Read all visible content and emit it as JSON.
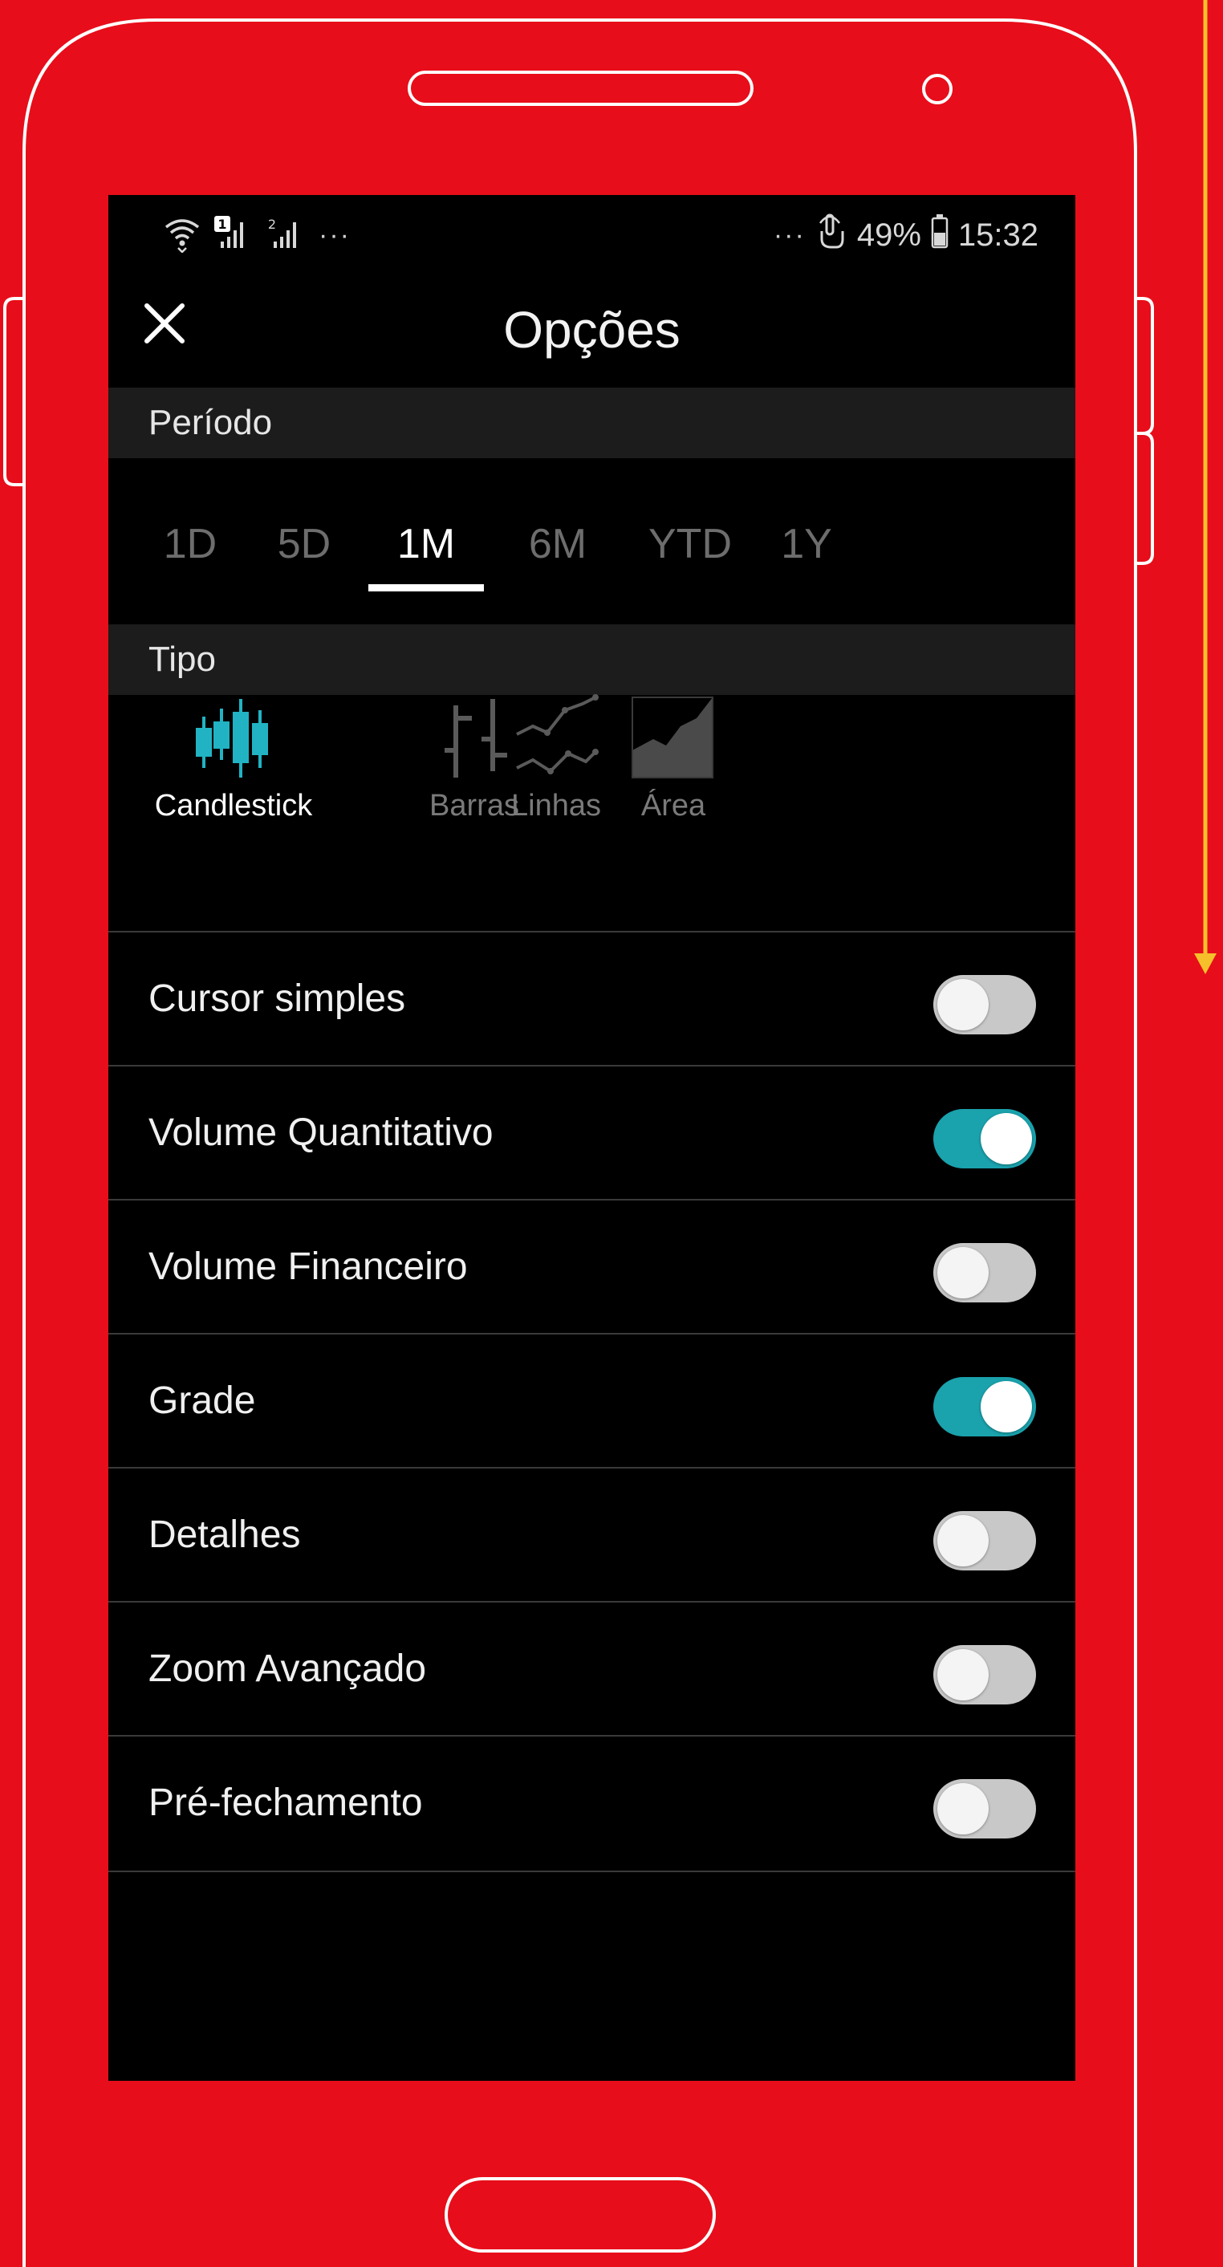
{
  "status_bar": {
    "left_dots": "···",
    "right_dots": "···",
    "battery": "49%",
    "time": "15:32",
    "sim1_badge": "1",
    "sim2_badge": "2"
  },
  "header": {
    "title": "Opções"
  },
  "sections": {
    "period": "Período",
    "type": "Tipo"
  },
  "period_tabs": [
    {
      "label": "1D",
      "active": false
    },
    {
      "label": "5D",
      "active": false
    },
    {
      "label": "1M",
      "active": true
    },
    {
      "label": "6M",
      "active": false
    },
    {
      "label": "YTD",
      "active": false
    },
    {
      "label": "1Y",
      "active": false
    }
  ],
  "chart_types": [
    {
      "label": "Candlestick",
      "icon": "candlestick-icon",
      "active": true
    },
    {
      "label": "Barras",
      "icon": "bars-icon",
      "active": false
    },
    {
      "label": "Linhas",
      "icon": "lines-icon",
      "active": false
    },
    {
      "label": "Área",
      "icon": "area-icon",
      "active": false
    }
  ],
  "options": [
    {
      "label": "Cursor simples",
      "on": false
    },
    {
      "label": "Volume Quantitativo",
      "on": true
    },
    {
      "label": "Volume Financeiro",
      "on": false
    },
    {
      "label": "Grade",
      "on": true
    },
    {
      "label": "Detalhes",
      "on": false
    },
    {
      "label": "Zoom Avançado",
      "on": false
    },
    {
      "label": "Pré-fechamento",
      "on": false
    }
  ],
  "colors": {
    "background": "#E80D1A",
    "accent": "#1aa2ad",
    "active_icon": "#21b3c3",
    "arrow": "#F6C02B"
  }
}
